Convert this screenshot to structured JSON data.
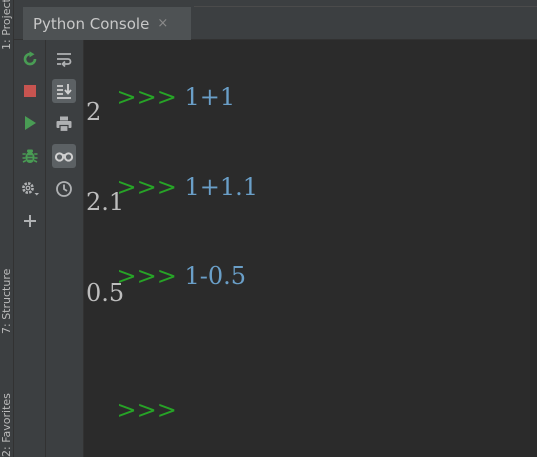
{
  "side_tabs": {
    "project": "1: Project",
    "structure": "7: Structure",
    "favorites": "2: Favorites"
  },
  "tab": {
    "title": "Python Console",
    "close": "×"
  },
  "toolbar_left": [
    {
      "name": "rerun-icon",
      "color": "#499c54"
    },
    {
      "name": "stop-icon",
      "color": "#c75450"
    },
    {
      "name": "run-icon",
      "color": "#499c54"
    },
    {
      "name": "debug-icon",
      "color": "#499c54"
    },
    {
      "name": "settings-icon",
      "color": "#afb1b3"
    },
    {
      "name": "add-icon",
      "color": "#afb1b3"
    }
  ],
  "toolbar_right": [
    {
      "name": "soft-wrap-icon"
    },
    {
      "name": "scroll-to-end-icon",
      "active": true
    },
    {
      "name": "print-icon"
    },
    {
      "name": "show-variables-icon",
      "active": true
    },
    {
      "name": "history-icon"
    }
  ],
  "console": {
    "prompt": ">>>",
    "entries": [
      {
        "input": "1+1",
        "output": "2"
      },
      {
        "input": "1+1.1",
        "output": "2.1"
      },
      {
        "input": "1-0.5",
        "output": "0.5"
      }
    ],
    "final_prompt": ">>>"
  },
  "colors": {
    "background": "#2b2b2b",
    "panel": "#3c3f41",
    "prompt": "#27a327",
    "input": "#6a9fc8",
    "output": "#bdbdbd"
  }
}
